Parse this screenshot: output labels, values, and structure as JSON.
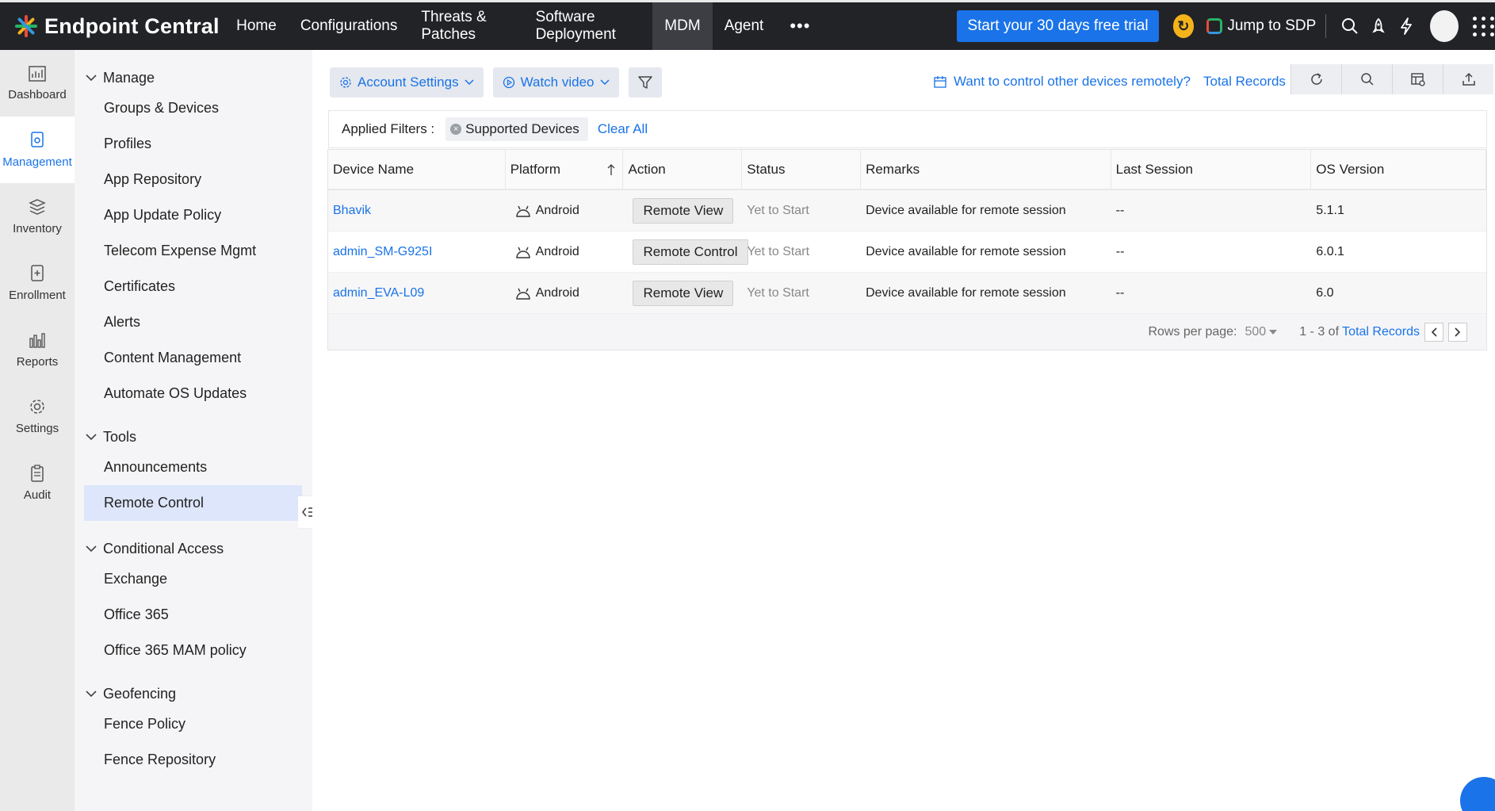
{
  "header": {
    "brand": "Endpoint Central",
    "nav": [
      {
        "label": "Home",
        "active": false
      },
      {
        "label": "Configurations",
        "active": false
      },
      {
        "label": "Threats & Patches",
        "active": false
      },
      {
        "label": "Software Deployment",
        "active": false
      },
      {
        "label": "MDM",
        "active": true
      },
      {
        "label": "Agent",
        "active": false
      }
    ],
    "more": "•••",
    "trial_label": "Start your 30 days free trial",
    "sdp_label": "Jump to SDP"
  },
  "rail": [
    {
      "label": "Dashboard",
      "icon": "dashboard-icon",
      "active": false
    },
    {
      "label": "Management",
      "icon": "management-icon",
      "active": true
    },
    {
      "label": "Inventory",
      "icon": "inventory-icon",
      "active": false
    },
    {
      "label": "Enrollment",
      "icon": "enrollment-icon",
      "active": false
    },
    {
      "label": "Reports",
      "icon": "reports-icon",
      "active": false
    },
    {
      "label": "Settings",
      "icon": "settings-icon",
      "active": false
    },
    {
      "label": "Audit",
      "icon": "audit-icon",
      "active": false
    }
  ],
  "subnav": {
    "manage": {
      "title": "Manage",
      "items": [
        "Groups & Devices",
        "Profiles",
        "App Repository",
        "App Update Policy",
        "Telecom Expense Mgmt",
        "Certificates",
        "Alerts",
        "Content Management",
        "Automate OS Updates"
      ]
    },
    "tools": {
      "title": "Tools",
      "items": [
        "Announcements",
        "Remote Control"
      ]
    },
    "conditional": {
      "title": "Conditional Access",
      "items": [
        "Exchange",
        "Office 365",
        "Office 365 MAM policy"
      ]
    },
    "geofencing": {
      "title": "Geofencing",
      "items": [
        "Fence Policy",
        "Fence Repository"
      ]
    }
  },
  "toolbar": {
    "account_settings": "Account Settings",
    "watch_video": "Watch video",
    "remote_link": "Want to control other devices remotely?",
    "total_records": "Total Records"
  },
  "filters": {
    "label": "Applied Filters :",
    "chip": "Supported Devices",
    "clear": "Clear All"
  },
  "table": {
    "columns": [
      "Device Name",
      "Platform",
      "Action",
      "Status",
      "Remarks",
      "Last Session",
      "OS Version"
    ],
    "rows": [
      {
        "name": "Bhavik",
        "platform": "Android",
        "action": "Remote View",
        "status": "Yet to Start",
        "remarks": "Device available for remote session",
        "last": "--",
        "os": "5.1.1"
      },
      {
        "name": "admin_SM-G925I",
        "platform": "Android",
        "action": "Remote Control",
        "status": "Yet to Start",
        "remarks": "Device available for remote session",
        "last": "--",
        "os": "6.0.1"
      },
      {
        "name": "admin_EVA-L09",
        "platform": "Android",
        "action": "Remote View",
        "status": "Yet to Start",
        "remarks": "Device available for remote session",
        "last": "--",
        "os": "6.0"
      }
    ],
    "footer": {
      "rows_label": "Rows per page:",
      "rows_value": "500",
      "range": "1 - 3 of",
      "total_link": "Total Records"
    }
  },
  "colors": {
    "accent": "#1a73e8",
    "topbar": "#222327",
    "trial": "#1a73e8"
  }
}
